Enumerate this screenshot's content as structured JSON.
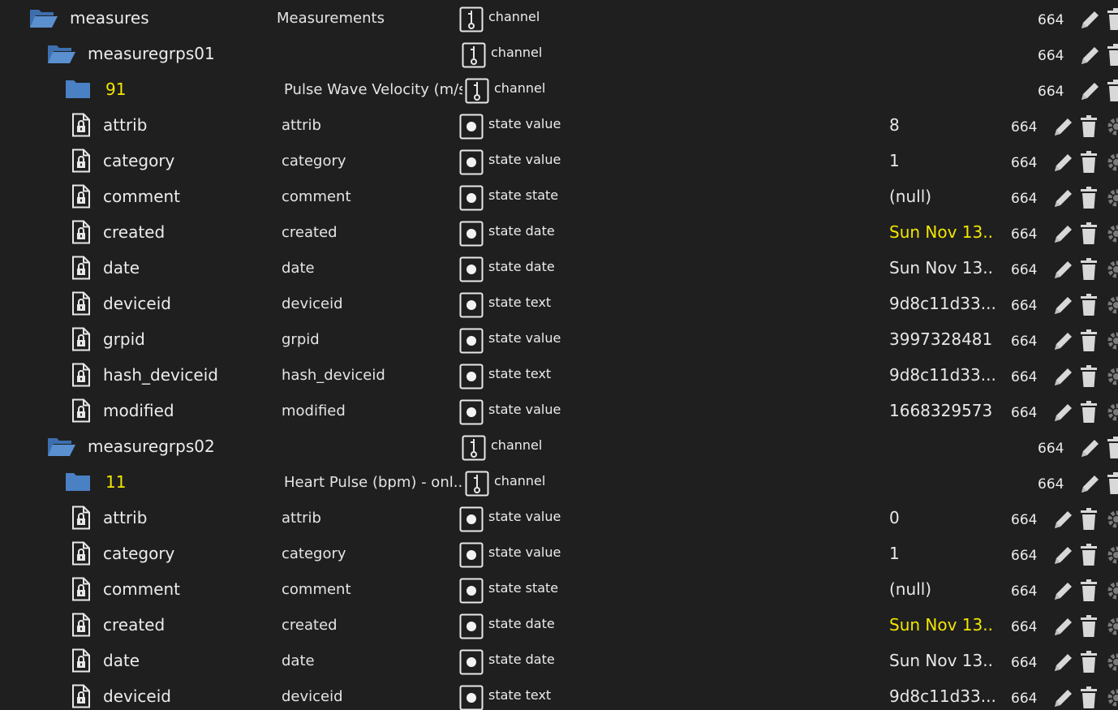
{
  "rows": [
    {
      "level": 0,
      "kind": "folder-open",
      "name": "measures",
      "desc": "Measurements",
      "type": "channel",
      "type_kind": "channel",
      "value": "",
      "acl": "664",
      "highlight_name": false,
      "highlight_value": false
    },
    {
      "level": 1,
      "kind": "folder-open",
      "name": "measuregrps01",
      "desc": "",
      "type": "channel",
      "type_kind": "channel",
      "value": "",
      "acl": "664",
      "highlight_name": false,
      "highlight_value": false
    },
    {
      "level": 2,
      "kind": "folder",
      "name": "91",
      "desc": "Pulse Wave Velocity (m/s)",
      "type": "channel",
      "type_kind": "channel",
      "value": "",
      "acl": "664",
      "highlight_name": true,
      "highlight_value": false
    },
    {
      "level": 3,
      "kind": "file",
      "name": "attrib",
      "desc": "attrib",
      "type": "state value",
      "type_kind": "state",
      "value": "8",
      "acl": "664",
      "highlight_name": false,
      "highlight_value": false
    },
    {
      "level": 3,
      "kind": "file",
      "name": "category",
      "desc": "category",
      "type": "state value",
      "type_kind": "state",
      "value": "1",
      "acl": "664",
      "highlight_name": false,
      "highlight_value": false
    },
    {
      "level": 3,
      "kind": "file",
      "name": "comment",
      "desc": "comment",
      "type": "state state",
      "type_kind": "state",
      "value": "(null)",
      "acl": "664",
      "highlight_name": false,
      "highlight_value": false
    },
    {
      "level": 3,
      "kind": "file",
      "name": "created",
      "desc": "created",
      "type": "state date",
      "type_kind": "state",
      "value": "Sun Nov 13...",
      "acl": "664",
      "highlight_name": false,
      "highlight_value": true
    },
    {
      "level": 3,
      "kind": "file",
      "name": "date",
      "desc": "date",
      "type": "state date",
      "type_kind": "state",
      "value": "Sun Nov 13...",
      "acl": "664",
      "highlight_name": false,
      "highlight_value": false
    },
    {
      "level": 3,
      "kind": "file",
      "name": "deviceid",
      "desc": "deviceid",
      "type": "state text",
      "type_kind": "state",
      "value": "9d8c11d33...",
      "acl": "664",
      "highlight_name": false,
      "highlight_value": false
    },
    {
      "level": 3,
      "kind": "file",
      "name": "grpid",
      "desc": "grpid",
      "type": "state value",
      "type_kind": "state",
      "value": "3997328481",
      "acl": "664",
      "highlight_name": false,
      "highlight_value": false
    },
    {
      "level": 3,
      "kind": "file",
      "name": "hash_deviceid",
      "desc": "hash_deviceid",
      "type": "state text",
      "type_kind": "state",
      "value": "9d8c11d33...",
      "acl": "664",
      "highlight_name": false,
      "highlight_value": false
    },
    {
      "level": 3,
      "kind": "file",
      "name": "modified",
      "desc": "modified",
      "type": "state value",
      "type_kind": "state",
      "value": "1668329573",
      "acl": "664",
      "highlight_name": false,
      "highlight_value": false
    },
    {
      "level": 1,
      "kind": "folder-open",
      "name": "measuregrps02",
      "desc": "",
      "type": "channel",
      "type_kind": "channel",
      "value": "",
      "acl": "664",
      "highlight_name": false,
      "highlight_value": false
    },
    {
      "level": 2,
      "kind": "folder",
      "name": "11",
      "desc": "Heart Pulse (bpm) - onl...",
      "type": "channel",
      "type_kind": "channel",
      "value": "",
      "acl": "664",
      "highlight_name": true,
      "highlight_value": false
    },
    {
      "level": 3,
      "kind": "file",
      "name": "attrib",
      "desc": "attrib",
      "type": "state value",
      "type_kind": "state",
      "value": "0",
      "acl": "664",
      "highlight_name": false,
      "highlight_value": false
    },
    {
      "level": 3,
      "kind": "file",
      "name": "category",
      "desc": "category",
      "type": "state value",
      "type_kind": "state",
      "value": "1",
      "acl": "664",
      "highlight_name": false,
      "highlight_value": false
    },
    {
      "level": 3,
      "kind": "file",
      "name": "comment",
      "desc": "comment",
      "type": "state state",
      "type_kind": "state",
      "value": "(null)",
      "acl": "664",
      "highlight_name": false,
      "highlight_value": false
    },
    {
      "level": 3,
      "kind": "file",
      "name": "created",
      "desc": "created",
      "type": "state date",
      "type_kind": "state",
      "value": "Sun Nov 13...",
      "acl": "664",
      "highlight_name": false,
      "highlight_value": true
    },
    {
      "level": 3,
      "kind": "file",
      "name": "date",
      "desc": "date",
      "type": "state date",
      "type_kind": "state",
      "value": "Sun Nov 13...",
      "acl": "664",
      "highlight_name": false,
      "highlight_value": false
    },
    {
      "level": 3,
      "kind": "file",
      "name": "deviceid",
      "desc": "deviceid",
      "type": "state text",
      "type_kind": "state",
      "value": "9d8c11d33...",
      "acl": "664",
      "highlight_name": false,
      "highlight_value": false
    }
  ],
  "icons": {
    "folder_open": "folder-open-icon",
    "folder": "folder-icon",
    "file": "file-lock-icon",
    "channel": "channel-icon",
    "state": "state-icon",
    "edit": "pencil-icon",
    "delete": "trash-icon",
    "settings": "gear-icon"
  },
  "colors": {
    "background": "#1f1f1f",
    "text": "#e8e8e8",
    "folder": "#4a80c4",
    "highlight_text": "#f2e600"
  }
}
